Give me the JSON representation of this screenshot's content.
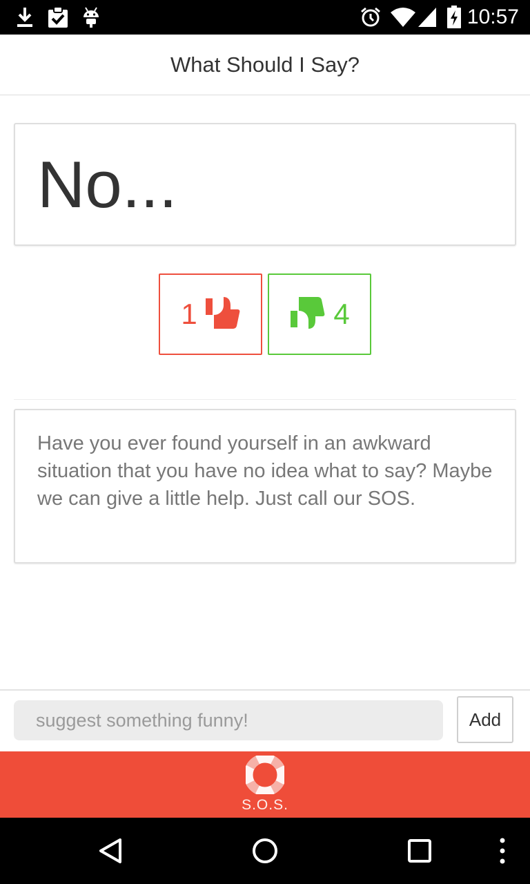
{
  "status_bar": {
    "time": "10:57",
    "icons": [
      "download-icon",
      "clipboard-check-icon",
      "android-icon",
      "alarm-icon",
      "wifi-icon",
      "signal-icon",
      "battery-charging-icon"
    ]
  },
  "header": {
    "title": "What Should I Say?"
  },
  "answer": {
    "text": "No..."
  },
  "votes": {
    "down_count": "1",
    "up_count": "4",
    "down_color": "#ee4f3d",
    "up_color": "#59c93a"
  },
  "description": {
    "text": "Have you ever found yourself in an awkward situation that you have no idea what to say? Maybe we can give a little help. Just call our SOS."
  },
  "suggest": {
    "placeholder": "suggest something funny!",
    "value": "",
    "add_label": "Add"
  },
  "sos": {
    "label": "S.O.S.",
    "color": "#ef4d39"
  },
  "nav_bar": {
    "icons": [
      "back-icon",
      "home-icon",
      "recents-icon",
      "overflow-menu-icon"
    ]
  }
}
